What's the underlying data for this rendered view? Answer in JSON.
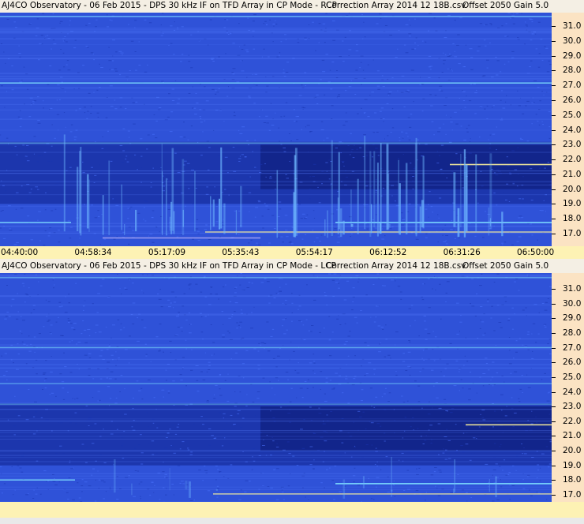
{
  "panels": [
    {
      "title": "AJ4CO Observatory - 06 Feb 2015 - DPS 30 kHz IF on TFD Array in CP Mode - RCP",
      "correction": "Correction Array 2014 12 18B.csv",
      "offset": "Offset 2050",
      "gain": "Gain 5.0"
    },
    {
      "title": "AJ4CO Observatory - 06 Feb 2015 - DPS 30 kHz IF on TFD Array in CP Mode - LCP",
      "correction": "Correction Array 2014 12 18B.csv",
      "offset": "Offset 2050",
      "gain": "Gain 5.0"
    }
  ],
  "time_labels": [
    "04:40:00",
    "04:58:34",
    "05:17:09",
    "05:35:43",
    "05:54:17",
    "06:12:52",
    "06:31:26",
    "06:50:00"
  ],
  "colors": {
    "background": "#2f52d8",
    "dark_band": "#0d1f8a",
    "bright": "#6fb8ff",
    "line_cyan": "#7fe0ff",
    "line_yellow": "#fff59a",
    "axis_bg": "#fbe3c3",
    "time_bg": "#fdf2b4"
  },
  "chart_data": [
    {
      "type": "heatmap",
      "name": "RCP",
      "x_range": [
        "04:40:00",
        "06:50:00"
      ],
      "y_range_mhz": [
        16.5,
        32.0
      ],
      "ylabels": [
        "31.0",
        "30.0",
        "29.0",
        "28.0",
        "27.0",
        "26.0",
        "25.0",
        "24.0",
        "23.0",
        "22.0",
        "21.0",
        "20.0",
        "19.0",
        "18.0",
        "17.0"
      ]
    },
    {
      "type": "heatmap",
      "name": "LCP",
      "x_range": [
        "04:40:00",
        "06:50:00"
      ],
      "y_range_mhz": [
        16.5,
        32.0
      ],
      "ylabels": [
        "31.0",
        "30.0",
        "29.0",
        "28.0",
        "27.0",
        "26.0",
        "25.0",
        "24.0",
        "23.0",
        "22.0",
        "21.0",
        "20.0",
        "19.0",
        "18.0",
        "17.0"
      ]
    }
  ]
}
